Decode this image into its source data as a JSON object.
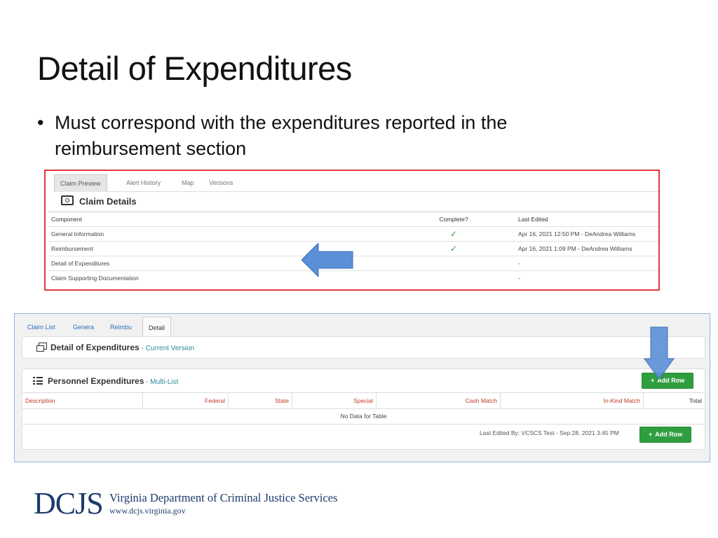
{
  "slide": {
    "title": "Detail of Expenditures",
    "bullet": "Must correspond with the expenditures reported in the reimbursement section"
  },
  "claim_preview": {
    "tabs": [
      "Claim Preview",
      "Alert History",
      "Map",
      "Versions"
    ],
    "panel_title": "Claim Details",
    "columns": {
      "component": "Component",
      "complete": "Complete?",
      "last_edited": "Last Edited"
    },
    "rows": [
      {
        "component": "General Information",
        "complete": "✓",
        "last_edited": "Apr 16, 2021 12:50 PM - DeAndrea Williams"
      },
      {
        "component": "Reimbursement",
        "complete": "✓",
        "last_edited": "Apr 16, 2021 1:09 PM - DeAndrea Williams"
      },
      {
        "component": "Detail of Expenditures",
        "complete": "",
        "last_edited": "-"
      },
      {
        "component": "Claim Supporting Documentation",
        "complete": "",
        "last_edited": "-"
      }
    ]
  },
  "detail_form": {
    "tabs": [
      "Claim List",
      "Genera",
      "Reimbu",
      "Detail"
    ],
    "header_title": "Detail of Expenditures",
    "header_sub": " - Current Version",
    "card_title": "Personnel Expenditures",
    "card_sub": " - Multi-List",
    "add_row_label": "Add Row",
    "columns": [
      "Description",
      "Federal",
      "State",
      "Special",
      "Cash Match",
      "In-Kind Match",
      "Total"
    ],
    "no_data": "No Data for Table",
    "last_edited": "Last Edited By: VCSCS Test - Sep 28, 2021 3:45 PM"
  },
  "footer": {
    "logo_mark": "DCJS",
    "org_name": "Virginia Department of Criminal Justice Services",
    "url": "www.dcjs.virginia.gov"
  },
  "colors": {
    "arrow": "#5b8fd6",
    "highlight_border": "#e03a3a",
    "button": "#2f9e3f"
  }
}
